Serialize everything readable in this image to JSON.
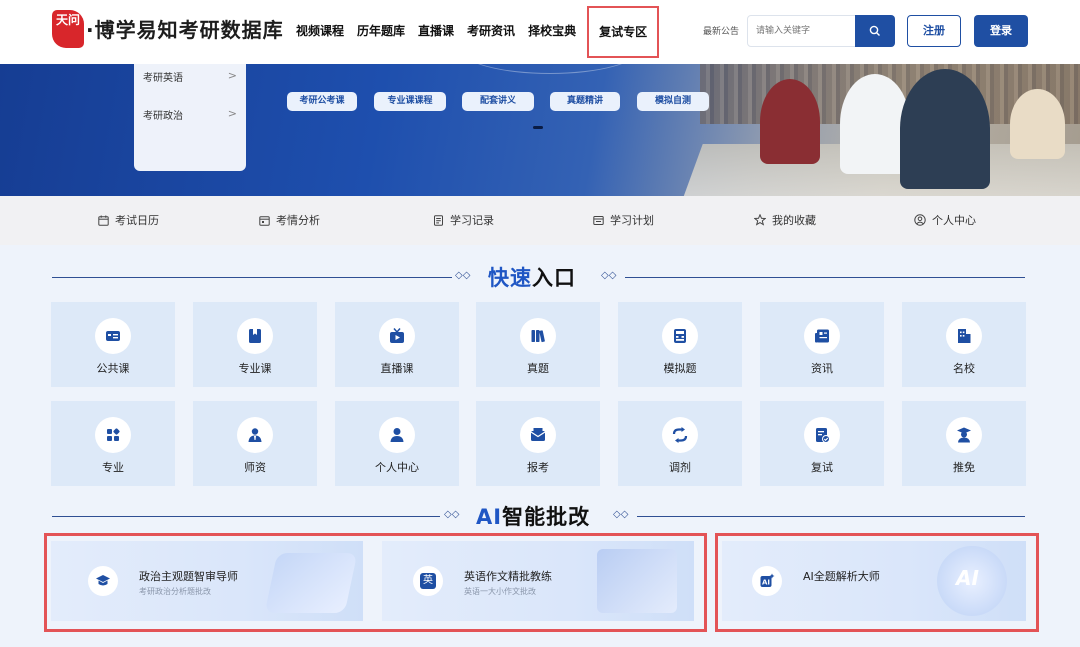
{
  "header": {
    "logo_mark": "天问",
    "logo_text": "·博学易知考研数据库",
    "nav": [
      "视频课程",
      "历年题库",
      "直播课",
      "考研资讯",
      "择校宝典",
      "复试专区"
    ],
    "notice": "最新公告",
    "search_placeholder": "请输入关键字",
    "register": "注册",
    "login": "登录"
  },
  "banner": {
    "menu": [
      {
        "label": "考研英语",
        "chevron": ">"
      },
      {
        "label": "考研政治",
        "chevron": ">"
      }
    ],
    "pills": [
      "考研公考课",
      "专业课课程",
      "配套讲义",
      "真题精讲",
      "模拟自测"
    ]
  },
  "func_bar": [
    {
      "label": "考试日历",
      "icon": "calendar-icon"
    },
    {
      "label": "考情分析",
      "icon": "calendar-chart-icon"
    },
    {
      "label": "学习记录",
      "icon": "document-icon"
    },
    {
      "label": "学习计划",
      "icon": "plan-icon"
    },
    {
      "label": "我的收藏",
      "icon": "star-icon"
    },
    {
      "label": "个人中心",
      "icon": "user-circle-icon"
    }
  ],
  "quick": {
    "title_hl": "快速",
    "title_rest": "入口",
    "row1": [
      {
        "label": "公共课",
        "icon": "id-card-icon"
      },
      {
        "label": "专业课",
        "icon": "bookmark-book-icon"
      },
      {
        "label": "直播课",
        "icon": "tv-play-icon"
      },
      {
        "label": "真题",
        "icon": "books-icon"
      },
      {
        "label": "模拟题",
        "icon": "calculator-icon"
      },
      {
        "label": "资讯",
        "icon": "news-icon"
      },
      {
        "label": "名校",
        "icon": "building-icon"
      }
    ],
    "row2": [
      {
        "label": "专业",
        "icon": "grid-icon"
      },
      {
        "label": "师资",
        "icon": "teacher-icon"
      },
      {
        "label": "个人中心",
        "icon": "person-icon"
      },
      {
        "label": "报考",
        "icon": "mail-icon"
      },
      {
        "label": "调剂",
        "icon": "swap-icon"
      },
      {
        "label": "复试",
        "icon": "checklist-icon"
      },
      {
        "label": "推免",
        "icon": "graduate-icon"
      }
    ]
  },
  "ai": {
    "title_hl": "AI",
    "title_rest": "智能批改",
    "cards": [
      {
        "title": "政治主观题智审导师",
        "sub": "考研政治分析题批改",
        "icon": "graduation-cap-icon"
      },
      {
        "title": "英语作文精批教练",
        "sub": "英语一大小作文批改",
        "icon": "english-icon",
        "badge": "英"
      },
      {
        "title": "AI全题解析大师",
        "sub": "",
        "icon": "ai-sparkle-icon"
      }
    ],
    "deco_text": "AI"
  },
  "colors": {
    "primary": "#1f4fa3",
    "highlight_frame": "#e35356",
    "tile_bg": "#dde9f8",
    "logo_red": "#d8262b"
  }
}
